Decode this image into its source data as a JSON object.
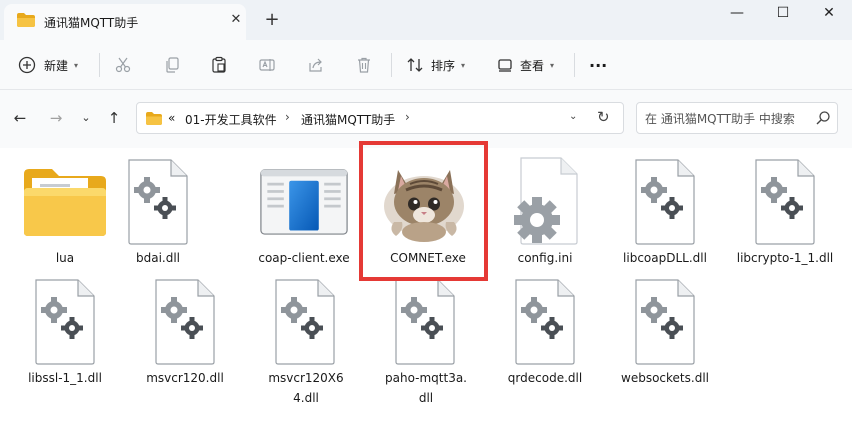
{
  "window": {
    "tab_title": "通讯猫MQTT助手",
    "tab_close": "✕",
    "new_tab": "+",
    "minimize": "—",
    "maximize": "☐",
    "close": "✕"
  },
  "toolbar": {
    "new_label": "新建",
    "sort_label": "排序",
    "view_label": "查看",
    "more": "···"
  },
  "address": {
    "overflow": "«",
    "crumbs": [
      "01-开发工具软件",
      "通讯猫MQTT助手"
    ],
    "separator": "›"
  },
  "search": {
    "placeholder": "在 通讯猫MQTT助手 中搜索"
  },
  "files": [
    {
      "name": "lua",
      "type": "folder"
    },
    {
      "name": "bdai.dll",
      "type": "dll"
    },
    {
      "name": "coap-client.exe",
      "type": "exe-window"
    },
    {
      "name": "COMNET.exe",
      "type": "exe-cat",
      "selected": true
    },
    {
      "name": "config.ini",
      "type": "ini"
    },
    {
      "name": "libcoapDLL.dll",
      "type": "dll"
    },
    {
      "name": "libcrypto-1_1.dll",
      "type": "dll"
    },
    {
      "name": "libssl-1_1.dll",
      "type": "dll"
    },
    {
      "name": "msvcr120.dll",
      "type": "dll"
    },
    {
      "name": "msvcr120X64.dll",
      "type": "dll"
    },
    {
      "name": "paho-mqtt3a.dll",
      "type": "dll"
    },
    {
      "name": "qrdecode.dll",
      "type": "dll"
    },
    {
      "name": "websockets.dll",
      "type": "dll"
    }
  ],
  "colors": {
    "highlight": "#e53935",
    "folder": "#f6c343",
    "accent": "#0a6ed1"
  }
}
